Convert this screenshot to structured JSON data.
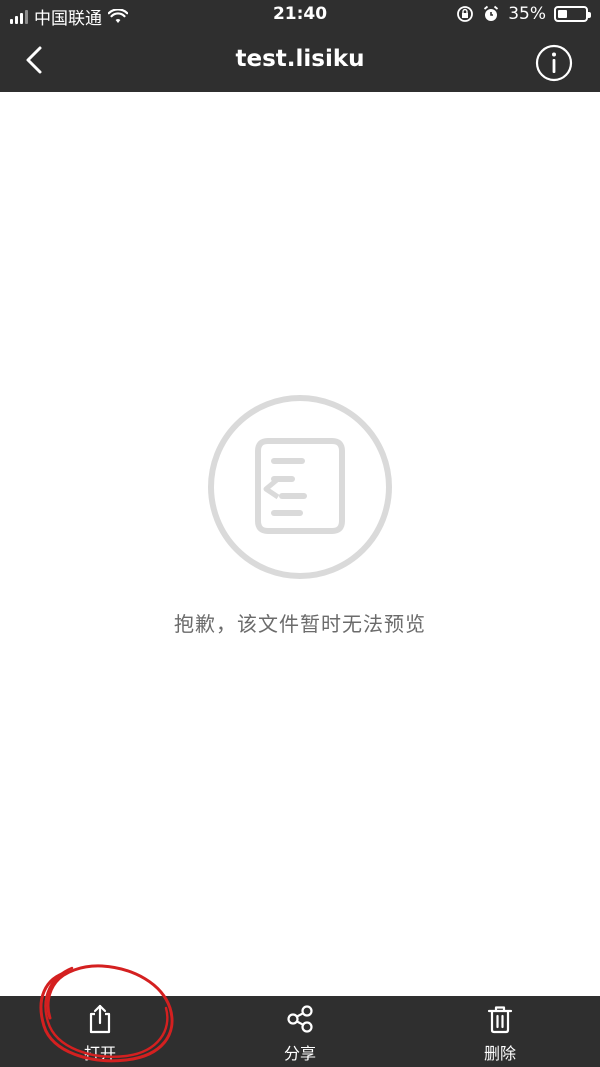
{
  "status_bar": {
    "carrier": "中国联通",
    "time": "21:40",
    "battery_percent": "35%",
    "battery_level": 0.35
  },
  "navbar": {
    "title": "test.lisiku",
    "back_icon": "chevron-left-icon",
    "info_icon": "info-icon"
  },
  "content": {
    "message": "抱歉，该文件暂时无法预览",
    "placeholder_icon": "file-document-icon"
  },
  "bottom_bar": {
    "actions": [
      {
        "label": "打开",
        "icon": "share-open-icon"
      },
      {
        "label": "分享",
        "icon": "share-nodes-icon"
      },
      {
        "label": "删除",
        "icon": "trash-icon"
      }
    ]
  },
  "colors": {
    "bar_background": "#2f2f2f",
    "content_background": "#ffffff",
    "placeholder_gray": "#dadada",
    "message_text": "#6b6b6b",
    "annotation_red": "#d42020"
  }
}
